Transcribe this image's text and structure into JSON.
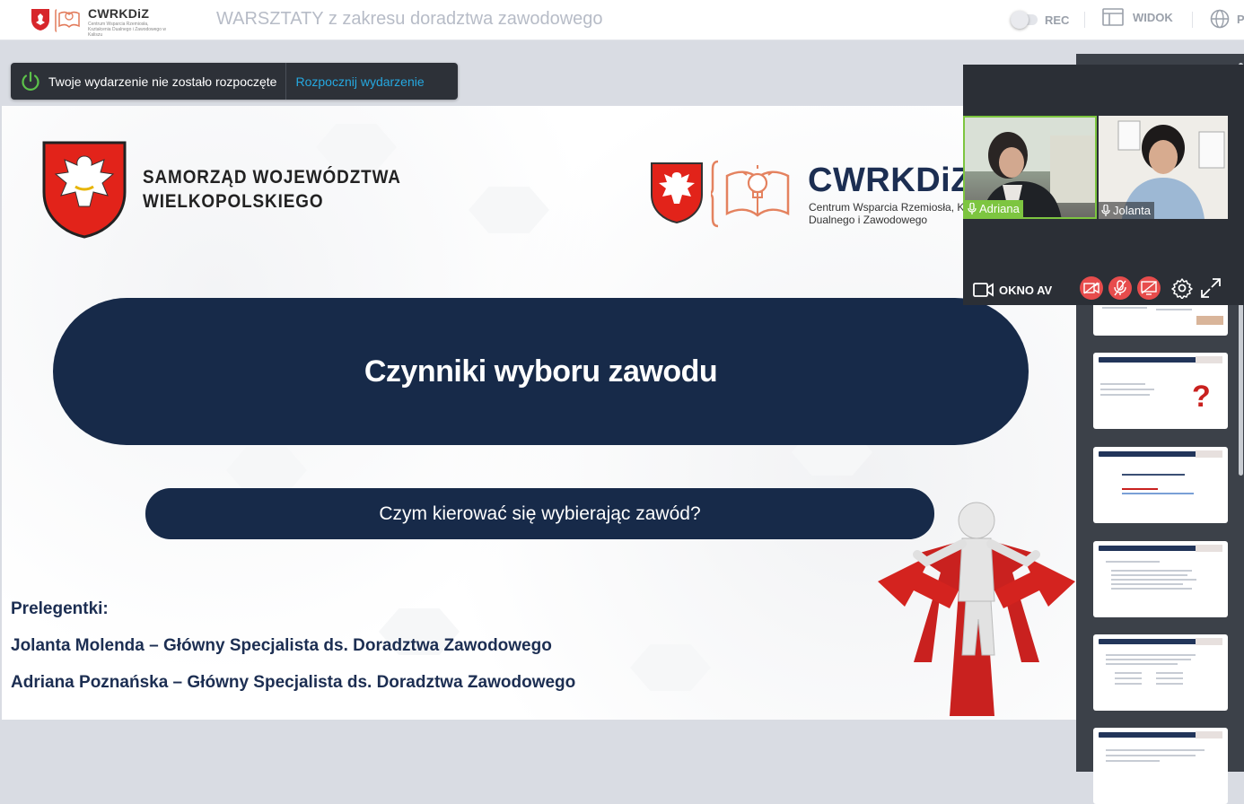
{
  "header": {
    "logo_brand": "CWRKDiZ",
    "logo_sub": "Centrum Wsparcia Rzemiosła, Kształcenia Dualnego i Zawodowego w Kaliszu",
    "event_title": "WARSZTATY z zakresu doradztwa zawodowego",
    "rec_label": "REC",
    "view_label": "WIDOK",
    "lang_label": "P"
  },
  "status": {
    "message": "Twoje wydarzenie nie zostało rozpoczęte",
    "start_label": "Rozpocznij wydarzenie"
  },
  "slide": {
    "org_line1": "SAMORZĄD WOJEWÓDZTWA",
    "org_line2": "WIELKOPOLSKIEGO",
    "cw_brand": "CWRKDiZ",
    "cw_sub_line1": "Centrum Wsparcia Rzemiosła, K",
    "cw_sub_line2": "Dualnego i Zawodowego",
    "title": "Czynniki wyboru zawodu",
    "subtitle": "Czym kierować się wybierając zawód?",
    "speakers_heading": "Prelegentki:",
    "speaker1": "Jolanta Molenda – Główny Specjalista ds. Doradztwa Zawodowego",
    "speaker2": "Adriana Poznańska – Główny Specjalista ds. Doradztwa Zawodowego"
  },
  "av": {
    "participants": [
      {
        "name": "Adriana"
      },
      {
        "name": "Jolanta"
      }
    ],
    "window_label": "OKNO AV"
  },
  "colors": {
    "navy": "#172a49",
    "accent_blue": "#25a8e0",
    "mute_red": "#e74c4c",
    "active_green": "#7dc540"
  }
}
